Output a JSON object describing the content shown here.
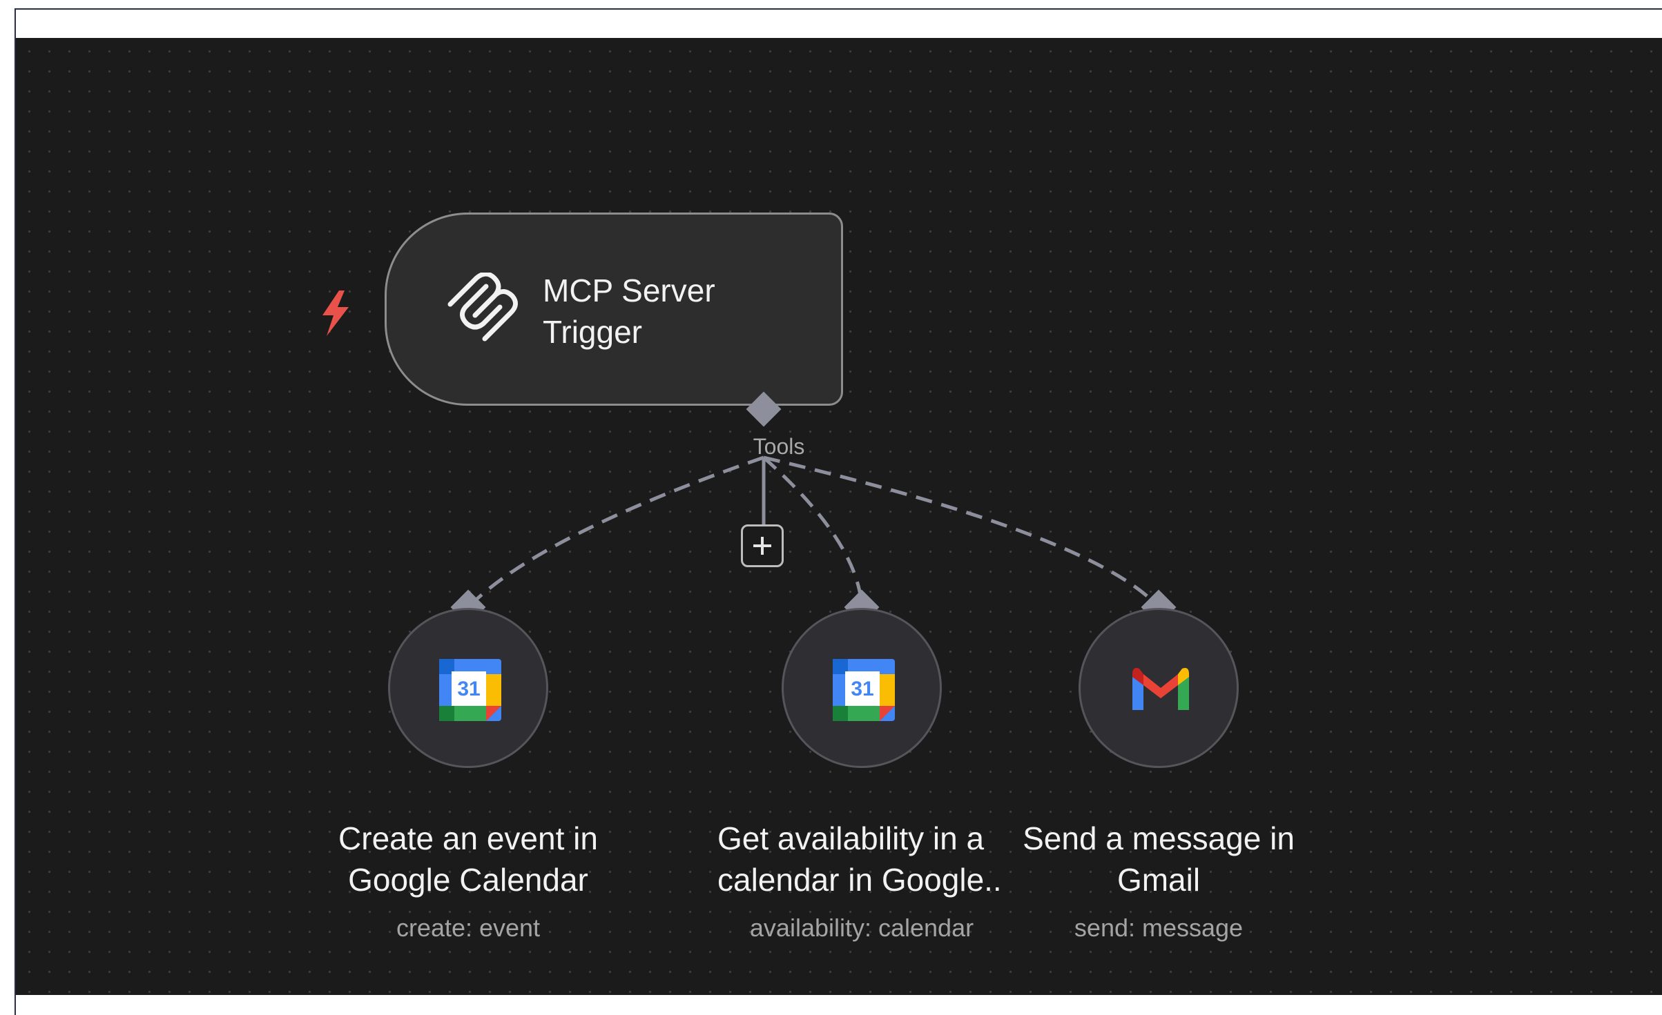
{
  "workflow": {
    "trigger": {
      "title": "MCP Server Trigger",
      "icon": "mcp-icon",
      "badge_icon": "lightning-bolt-icon",
      "connection_label": "Tools"
    },
    "add_tool": {
      "icon": "plus-icon"
    },
    "tools": [
      {
        "title": "Create an event in Google Calendar",
        "subtitle": "create: event",
        "icon": "google-calendar-icon",
        "icon_text": "31"
      },
      {
        "title": "Get availability in a calendar in Google..",
        "subtitle": "availability: calendar",
        "icon": "google-calendar-icon",
        "icon_text": "31"
      },
      {
        "title": "Send a message in Gmail",
        "subtitle": "send: message",
        "icon": "gmail-icon"
      }
    ]
  },
  "colors": {
    "canvas_background": "#1b1b1b",
    "node_background": "#2d2d2d",
    "node_border": "#8d8d8d",
    "connector": "#8d8f9c",
    "bolt": "#e8524a"
  }
}
